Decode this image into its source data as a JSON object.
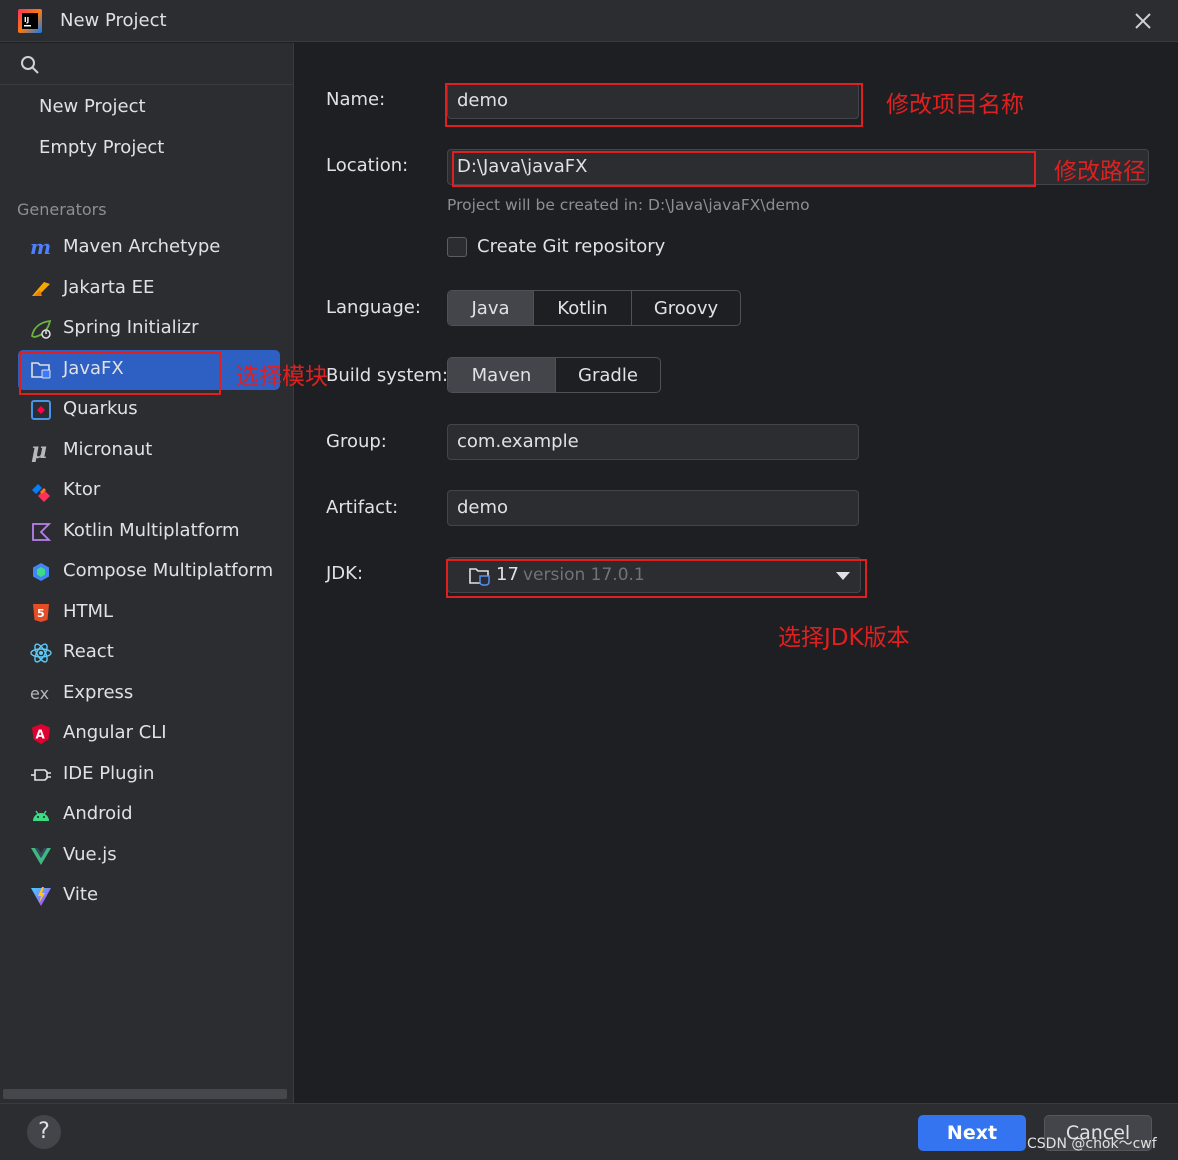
{
  "window": {
    "title": "New Project"
  },
  "sidebar": {
    "top_items": [
      {
        "label": "New Project"
      },
      {
        "label": "Empty Project"
      }
    ],
    "section_title": "Generators",
    "generators": [
      {
        "label": "Maven Archetype",
        "icon": "maven-icon"
      },
      {
        "label": "Jakarta EE",
        "icon": "jakarta-icon"
      },
      {
        "label": "Spring Initializr",
        "icon": "spring-icon"
      },
      {
        "label": "JavaFX",
        "icon": "javafx-icon",
        "selected": true
      },
      {
        "label": "Quarkus",
        "icon": "quarkus-icon"
      },
      {
        "label": "Micronaut",
        "icon": "micronaut-icon"
      },
      {
        "label": "Ktor",
        "icon": "ktor-icon"
      },
      {
        "label": "Kotlin Multiplatform",
        "icon": "kotlin-icon"
      },
      {
        "label": "Compose Multiplatform",
        "icon": "compose-icon"
      },
      {
        "label": "HTML",
        "icon": "html5-icon"
      },
      {
        "label": "React",
        "icon": "react-icon"
      },
      {
        "label": "Express",
        "icon": "express-icon"
      },
      {
        "label": "Angular CLI",
        "icon": "angular-icon"
      },
      {
        "label": "IDE Plugin",
        "icon": "plugin-icon"
      },
      {
        "label": "Android",
        "icon": "android-icon"
      },
      {
        "label": "Vue.js",
        "icon": "vue-icon"
      },
      {
        "label": "Vite",
        "icon": "vite-icon"
      }
    ]
  },
  "form": {
    "name_label": "Name:",
    "name_value": "demo",
    "location_label": "Location:",
    "location_value": "D:\\Java\\javaFX",
    "location_hint": "Project will be created in: D:\\Java\\javaFX\\demo",
    "git_label": "Create Git repository",
    "git_checked": false,
    "language_label": "Language:",
    "language_options": [
      "Java",
      "Kotlin",
      "Groovy"
    ],
    "language_selected": "Java",
    "build_label": "Build system:",
    "build_options": [
      "Maven",
      "Gradle"
    ],
    "build_selected": "Maven",
    "group_label": "Group:",
    "group_value": "com.example",
    "artifact_label": "Artifact:",
    "artifact_value": "demo",
    "jdk_label": "JDK:",
    "jdk_number": "17",
    "jdk_version": "version 17.0.1"
  },
  "annotations": {
    "name": "修改项目名称",
    "location": "修改路径",
    "module": "选择模块",
    "jdk": "选择JDK版本"
  },
  "footer": {
    "help_label": "?",
    "next_label": "Next",
    "cancel_label": "Cancel"
  },
  "watermark": "CSDN @chok～cwf",
  "colors": {
    "accent": "#3574f0",
    "selection": "#2e5fc2",
    "annotation": "#e02020"
  }
}
